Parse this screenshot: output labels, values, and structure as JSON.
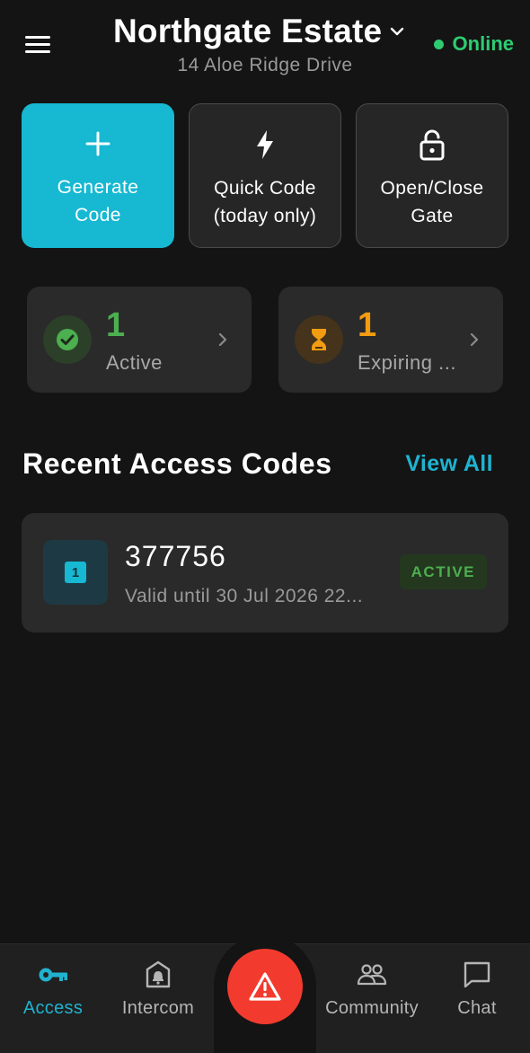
{
  "header": {
    "menu_icon": "hamburger-menu-icon",
    "estate_name": "Northgate Estate",
    "dropdown_icon": "chevron-down-icon",
    "address": "14 Aloe Ridge Drive",
    "status_text": "Online",
    "status_color": "#2ecc71"
  },
  "actions": [
    {
      "icon": "plus-icon",
      "label": "Generate\nCode",
      "color": "#16b8d2"
    },
    {
      "icon": "lightning-bolt-icon",
      "label": "Quick Code\n(today only)"
    },
    {
      "icon": "padlock-icon",
      "label": "Open/Close\nGate"
    }
  ],
  "stats": [
    {
      "icon": "check-circle-icon",
      "value": "1",
      "label": "Active",
      "color": "#4caf50"
    },
    {
      "icon": "hourglass-icon",
      "value": "1",
      "label": "Expiring ...",
      "color": "#f39c12"
    }
  ],
  "recent": {
    "title": "Recent Access Codes",
    "view_all": "View All",
    "codes": [
      {
        "icon_text": "1",
        "code": "377756",
        "valid": "Valid until 30 Jul 2026 22...",
        "status": "ACTIVE"
      }
    ]
  },
  "nav": {
    "items": [
      {
        "icon": "key-icon",
        "label": "Access",
        "active": true
      },
      {
        "icon": "intercom-bell-icon",
        "label": "Intercom"
      },
      {
        "icon": "community-people-icon",
        "label": "Community"
      },
      {
        "icon": "chat-bubble-icon",
        "label": "Chat"
      }
    ],
    "panic_icon": "warning-triangle-icon",
    "active_color": "#1fb3d0",
    "panic_color": "#f23b2e"
  }
}
